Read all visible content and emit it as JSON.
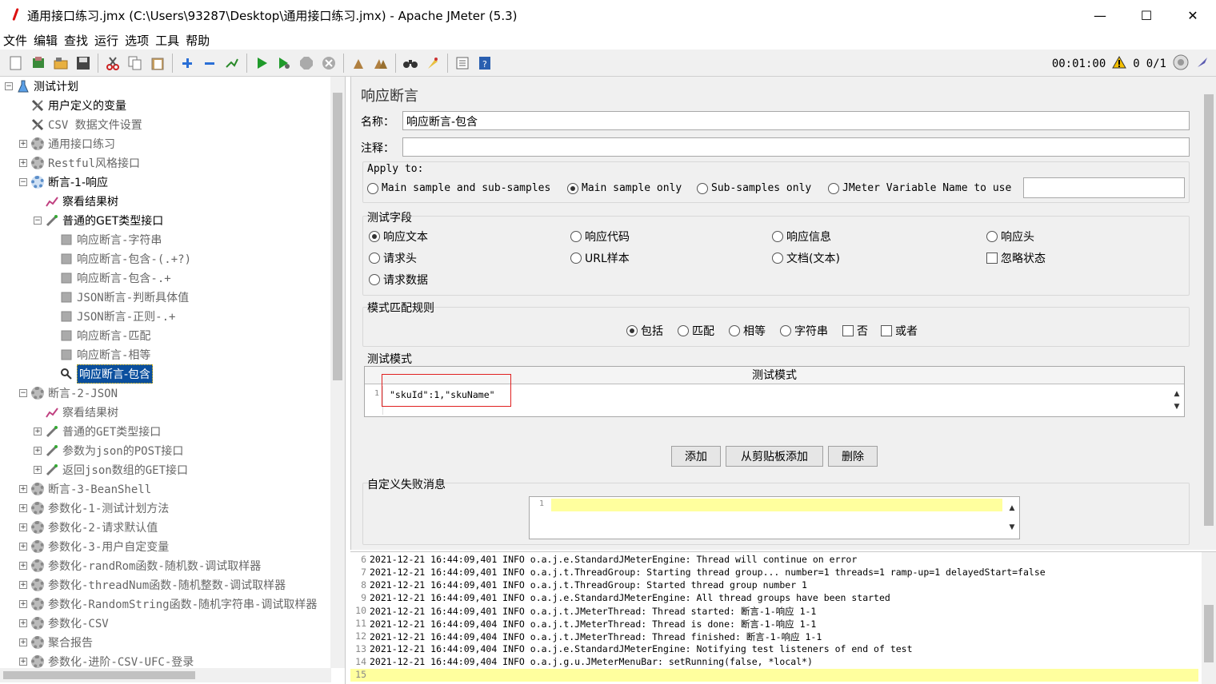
{
  "window": {
    "title": "通用接口练习.jmx (C:\\Users\\93287\\Desktop\\通用接口练习.jmx) - Apache JMeter (5.3)",
    "minimize": "—",
    "maximize": "☐",
    "close": "✕"
  },
  "menu": [
    "文件",
    "编辑",
    "查找",
    "运行",
    "选项",
    "工具",
    "帮助"
  ],
  "toolbar": {
    "timer": "00:01:00",
    "warnings": "0",
    "threads": "0/1"
  },
  "tree": [
    {
      "label": "测试计划",
      "depth": 0,
      "icon": "flask-icon",
      "toggle": "−",
      "muted": false
    },
    {
      "label": "用户定义的变量",
      "depth": 1,
      "icon": "wrench-icon",
      "toggle": "",
      "muted": false
    },
    {
      "label": "CSV 数据文件设置",
      "depth": 1,
      "icon": "wrench-icon",
      "toggle": "",
      "muted": true
    },
    {
      "label": "通用接口练习",
      "depth": 1,
      "icon": "gear-icon",
      "toggle": "+",
      "muted": true
    },
    {
      "label": "Restful风格接口",
      "depth": 1,
      "icon": "gear-icon",
      "toggle": "+",
      "muted": true
    },
    {
      "label": "断言-1-响应",
      "depth": 1,
      "icon": "gear-active-icon",
      "toggle": "−",
      "muted": false
    },
    {
      "label": "察看结果树",
      "depth": 2,
      "icon": "graph-icon",
      "toggle": "",
      "muted": false
    },
    {
      "label": "普通的GET类型接口",
      "depth": 2,
      "icon": "pipette-icon",
      "toggle": "−",
      "muted": false
    },
    {
      "label": "响应断言-字符串",
      "depth": 3,
      "icon": "assertion-icon",
      "toggle": "",
      "muted": true
    },
    {
      "label": "响应断言-包含-(.+?)",
      "depth": 3,
      "icon": "assertion-icon",
      "toggle": "",
      "muted": true
    },
    {
      "label": "响应断言-包含-.+",
      "depth": 3,
      "icon": "assertion-icon",
      "toggle": "",
      "muted": true
    },
    {
      "label": "JSON断言-判断具体值",
      "depth": 3,
      "icon": "assertion-icon",
      "toggle": "",
      "muted": true
    },
    {
      "label": "JSON断言-正则-.+",
      "depth": 3,
      "icon": "assertion-icon",
      "toggle": "",
      "muted": true
    },
    {
      "label": "响应断言-匹配",
      "depth": 3,
      "icon": "assertion-icon",
      "toggle": "",
      "muted": true
    },
    {
      "label": "响应断言-相等",
      "depth": 3,
      "icon": "assertion-icon",
      "toggle": "",
      "muted": true
    },
    {
      "label": "响应断言-包含",
      "depth": 3,
      "icon": "magnifier-icon",
      "toggle": "",
      "muted": false,
      "selected": true
    },
    {
      "label": "断言-2-JSON",
      "depth": 1,
      "icon": "gear-icon",
      "toggle": "−",
      "muted": true
    },
    {
      "label": "察看结果树",
      "depth": 2,
      "icon": "graph-icon",
      "toggle": "",
      "muted": true
    },
    {
      "label": "普通的GET类型接口",
      "depth": 2,
      "icon": "pipette-icon",
      "toggle": "+",
      "muted": true
    },
    {
      "label": "参数为json的POST接口",
      "depth": 2,
      "icon": "pipette-icon",
      "toggle": "+",
      "muted": true
    },
    {
      "label": "返回json数组的GET接口",
      "depth": 2,
      "icon": "pipette-icon",
      "toggle": "+",
      "muted": true
    },
    {
      "label": "断言-3-BeanShell",
      "depth": 1,
      "icon": "gear-icon",
      "toggle": "+",
      "muted": true
    },
    {
      "label": "参数化-1-测试计划方法",
      "depth": 1,
      "icon": "gear-icon",
      "toggle": "+",
      "muted": true
    },
    {
      "label": "参数化-2-请求默认值",
      "depth": 1,
      "icon": "gear-icon",
      "toggle": "+",
      "muted": true
    },
    {
      "label": "参数化-3-用户自定变量",
      "depth": 1,
      "icon": "gear-icon",
      "toggle": "+",
      "muted": true
    },
    {
      "label": "参数化-randRom函数-随机数-调试取样器",
      "depth": 1,
      "icon": "gear-icon",
      "toggle": "+",
      "muted": true
    },
    {
      "label": "参数化-threadNum函数-随机整数-调试取样器",
      "depth": 1,
      "icon": "gear-icon",
      "toggle": "+",
      "muted": true
    },
    {
      "label": "参数化-RandomString函数-随机字符串-调试取样器",
      "depth": 1,
      "icon": "gear-icon",
      "toggle": "+",
      "muted": true
    },
    {
      "label": "参数化-CSV",
      "depth": 1,
      "icon": "gear-icon",
      "toggle": "+",
      "muted": true
    },
    {
      "label": "聚合报告",
      "depth": 1,
      "icon": "gear-icon",
      "toggle": "+",
      "muted": true
    },
    {
      "label": "参数化-进阶-CSV-UFC-登录",
      "depth": 1,
      "icon": "gear-icon",
      "toggle": "+",
      "muted": true
    }
  ],
  "panel": {
    "heading": "响应断言",
    "name_label": "名称：",
    "name_value": "响应断言-包含",
    "comment_label": "注释：",
    "comment_value": "",
    "apply_to_label": "Apply to:",
    "apply_to": [
      {
        "label": "Main sample and sub-samples",
        "checked": false
      },
      {
        "label": "Main sample only",
        "checked": true
      },
      {
        "label": "Sub-samples only",
        "checked": false
      },
      {
        "label": "JMeter Variable Name to use",
        "checked": false
      }
    ],
    "apply_var_value": "",
    "field_label": "测试字段",
    "fields": [
      {
        "label": "响应文本",
        "type": "radio",
        "checked": true
      },
      {
        "label": "响应代码",
        "type": "radio",
        "checked": false
      },
      {
        "label": "响应信息",
        "type": "radio",
        "checked": false
      },
      {
        "label": "响应头",
        "type": "radio",
        "checked": false
      },
      {
        "label": "请求头",
        "type": "radio",
        "checked": false
      },
      {
        "label": "URL样本",
        "type": "radio",
        "checked": false
      },
      {
        "label": "文档(文本)",
        "type": "radio",
        "checked": false
      },
      {
        "label": "忽略状态",
        "type": "check",
        "checked": false
      },
      {
        "label": "请求数据",
        "type": "radio",
        "checked": false
      }
    ],
    "rule_label": "模式匹配规则",
    "rules": [
      {
        "label": "包括",
        "type": "radio",
        "checked": true
      },
      {
        "label": "匹配",
        "type": "radio",
        "checked": false
      },
      {
        "label": "相等",
        "type": "radio",
        "checked": false
      },
      {
        "label": "字符串",
        "type": "radio",
        "checked": false
      },
      {
        "label": "否",
        "type": "check",
        "checked": false
      },
      {
        "label": "或者",
        "type": "check",
        "checked": false
      }
    ],
    "pattern_label": "测试模式",
    "pattern_column": "测试模式",
    "pattern_line_no": "1",
    "pattern_value": "\"skuId\":1,\"skuName\"",
    "btn_add": "添加",
    "btn_clipboard": "从剪贴板添加",
    "btn_delete": "删除",
    "fail_label": "自定义失败消息",
    "fail_line_no": "1"
  },
  "log": [
    {
      "n": "6",
      "text": "2021-12-21 16:44:09,401 INFO o.a.j.e.StandardJMeterEngine: Thread will continue on error"
    },
    {
      "n": "7",
      "text": "2021-12-21 16:44:09,401 INFO o.a.j.t.ThreadGroup: Starting thread group... number=1 threads=1 ramp-up=1 delayedStart=false"
    },
    {
      "n": "8",
      "text": "2021-12-21 16:44:09,401 INFO o.a.j.t.ThreadGroup: Started thread group number 1"
    },
    {
      "n": "9",
      "text": "2021-12-21 16:44:09,401 INFO o.a.j.e.StandardJMeterEngine: All thread groups have been started"
    },
    {
      "n": "10",
      "text": "2021-12-21 16:44:09,401 INFO o.a.j.t.JMeterThread: Thread started: 断言-1-响应 1-1"
    },
    {
      "n": "11",
      "text": "2021-12-21 16:44:09,404 INFO o.a.j.t.JMeterThread: Thread is done: 断言-1-响应 1-1"
    },
    {
      "n": "12",
      "text": "2021-12-21 16:44:09,404 INFO o.a.j.t.JMeterThread: Thread finished: 断言-1-响应 1-1"
    },
    {
      "n": "13",
      "text": "2021-12-21 16:44:09,404 INFO o.a.j.e.StandardJMeterEngine: Notifying test listeners of end of test"
    },
    {
      "n": "14",
      "text": "2021-12-21 16:44:09,404 INFO o.a.j.g.u.JMeterMenuBar: setRunning(false, *local*)"
    },
    {
      "n": "15",
      "text": ""
    }
  ],
  "colors": {
    "selection": "#0a4f9e",
    "highlight_line": "#ffff9e",
    "pattern_border": "#e02020"
  }
}
